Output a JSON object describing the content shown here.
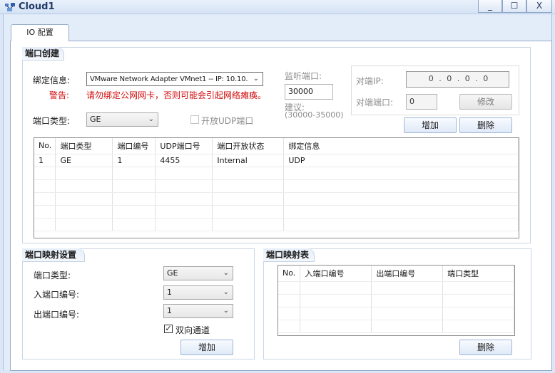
{
  "window": {
    "title": "Cloud1",
    "minimize": "_",
    "maximize": "☐",
    "close": "X"
  },
  "tabs": [
    {
      "label": "IO 配置"
    }
  ],
  "port_create": {
    "title": "端口创建",
    "bind_label": "绑定信息:",
    "bind_value": "VMware Network Adapter VMnet1 -- IP: 10.10.",
    "warn_label": "警告:",
    "warn_text": "请勿绑定公网网卡，否则可能会引起网络瘫痪。",
    "listen_port_label": "监听端口:",
    "listen_port_value": "30000",
    "suggest_label": "建议:",
    "suggest_range": "(30000-35000)",
    "port_type_label": "端口类型:",
    "port_type_value": "GE",
    "open_udp_label": "开放UDP端口",
    "remote_ip_label": "对端IP:",
    "remote_ip_value": "0 . 0 . 0 . 0",
    "remote_port_label": "对端端口:",
    "remote_port_value": "0",
    "modify_button": "修改",
    "add_button": "增加",
    "delete_button": "删除",
    "table": {
      "headers": [
        "No.",
        "端口类型",
        "端口编号",
        "UDP端口号",
        "端口开放状态",
        "绑定信息"
      ],
      "rows": [
        [
          "1",
          "GE",
          "1",
          "4455",
          "Internal",
          "UDP"
        ]
      ]
    }
  },
  "port_mapping_settings": {
    "title": "端口映射设置",
    "port_type_label": "端口类型:",
    "port_type_value": "GE",
    "in_port_label": "入端口编号:",
    "in_port_value": "1",
    "out_port_label": "出端口编号:",
    "out_port_value": "1",
    "bidirectional_label": "双向通道",
    "bidirectional_checked": true,
    "add_button": "增加"
  },
  "port_mapping_table": {
    "title": "端口映射表",
    "headers": [
      "No.",
      "入端口编号",
      "出端口编号",
      "端口类型"
    ],
    "delete_button": "删除"
  }
}
